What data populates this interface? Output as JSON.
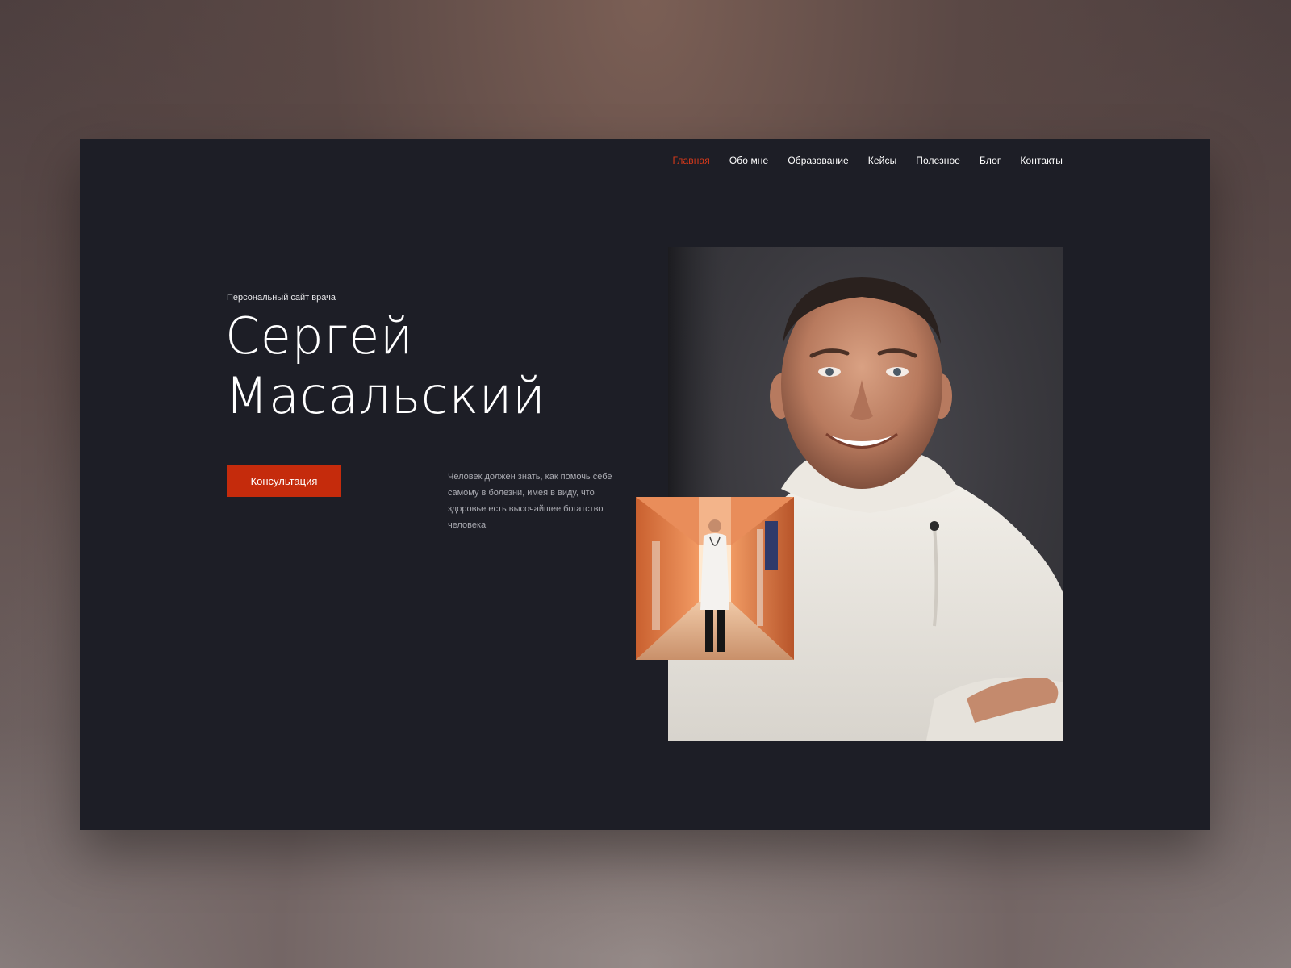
{
  "nav": {
    "items": [
      {
        "label": "Главная",
        "active": true
      },
      {
        "label": "Обо мне",
        "active": false
      },
      {
        "label": "Образование",
        "active": false
      },
      {
        "label": "Кейсы",
        "active": false
      },
      {
        "label": "Полезное",
        "active": false
      },
      {
        "label": "Блог",
        "active": false
      },
      {
        "label": "Контакты",
        "active": false
      }
    ]
  },
  "hero": {
    "kicker": "Персональный сайт врача",
    "first_name": "Сергей",
    "last_name": "Масальский",
    "cta_label": "Консультация",
    "quote": "Человек должен знать, как помочь себе самому в болезни, имея в виду, что здоровье есть высочайшее богатство человека"
  },
  "images": {
    "portrait": "doctor-portrait-photo",
    "corridor": "doctor-in-hospital-corridor-photo"
  },
  "colors": {
    "page_bg": "#1d1e26",
    "accent": "#c52b0c",
    "nav_active": "#d7391a",
    "text": "#ffffff",
    "muted_text": "#a9aab1"
  }
}
